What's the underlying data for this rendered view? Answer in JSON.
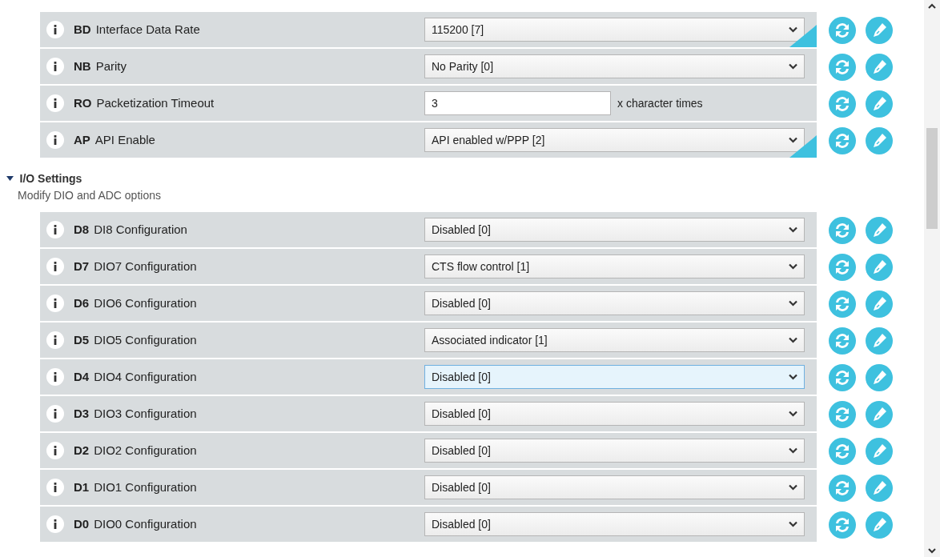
{
  "groups": [
    {
      "rows": [
        {
          "code": "BD",
          "label": "Interface Data Rate",
          "kind": "select",
          "value": "115200 [7]",
          "changed": true,
          "focused": false
        },
        {
          "code": "NB",
          "label": "Parity",
          "kind": "select",
          "value": "No Parity [0]",
          "changed": false,
          "focused": false
        },
        {
          "code": "RO",
          "label": "Packetization Timeout",
          "kind": "text",
          "value": "3",
          "suffix": "x character times",
          "changed": false,
          "focused": false
        },
        {
          "code": "AP",
          "label": "API Enable",
          "kind": "select",
          "value": "API enabled w/PPP [2]",
          "changed": true,
          "focused": false
        }
      ]
    },
    {
      "title": "I/O Settings",
      "subtitle": "Modify DIO and ADC options",
      "expanded": true,
      "rows": [
        {
          "code": "D8",
          "label": "DI8 Configuration",
          "kind": "select",
          "value": "Disabled [0]",
          "changed": false,
          "focused": false
        },
        {
          "code": "D7",
          "label": "DIO7 Configuration",
          "kind": "select",
          "value": "CTS flow control [1]",
          "changed": false,
          "focused": false
        },
        {
          "code": "D6",
          "label": "DIO6 Configuration",
          "kind": "select",
          "value": "Disabled [0]",
          "changed": false,
          "focused": false
        },
        {
          "code": "D5",
          "label": "DIO5 Configuration",
          "kind": "select",
          "value": "Associated indicator [1]",
          "changed": false,
          "focused": false
        },
        {
          "code": "D4",
          "label": "DIO4 Configuration",
          "kind": "select",
          "value": "Disabled [0]",
          "changed": false,
          "focused": true
        },
        {
          "code": "D3",
          "label": "DIO3 Configuration",
          "kind": "select",
          "value": "Disabled [0]",
          "changed": false,
          "focused": false
        },
        {
          "code": "D2",
          "label": "DIO2 Configuration",
          "kind": "select",
          "value": "Disabled [0]",
          "changed": false,
          "focused": false
        },
        {
          "code": "D1",
          "label": "DIO1 Configuration",
          "kind": "select",
          "value": "Disabled [0]",
          "changed": false,
          "focused": false
        },
        {
          "code": "D0",
          "label": "DIO0 Configuration",
          "kind": "select",
          "value": "Disabled [0]",
          "changed": false,
          "focused": false
        }
      ]
    }
  ]
}
